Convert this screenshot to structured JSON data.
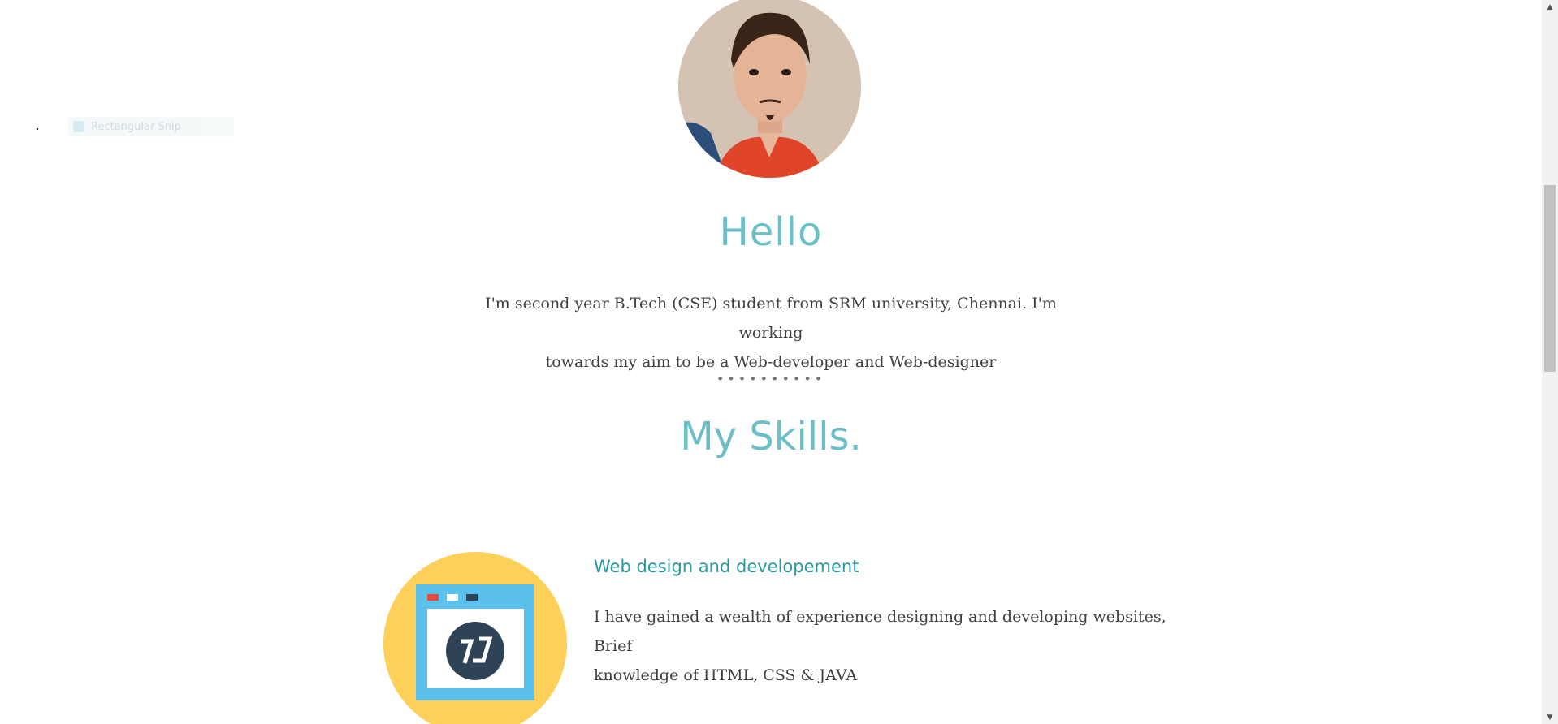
{
  "snip": {
    "label": "Rectangular Snip"
  },
  "profile": {
    "heading": "Hello",
    "intro_line1": "I'm second year B.Tech (CSE) student from SRM university, Chennai. I'm working",
    "intro_line2": "towards my aim to be a Web-developer and Web-designer"
  },
  "separator": "••••••••••",
  "skills": {
    "title": "My Skills.",
    "items": [
      {
        "title": "Web design and developement",
        "desc_line1": "I have gained a wealth of experience designing and developing websites, Brief",
        "desc_line2": "knowledge of HTML, CSS & JAVA",
        "icon": "browser-window-icon"
      }
    ]
  },
  "colors": {
    "accent": "#6bbfc5",
    "skill_title": "#2a9aa0",
    "icon_bg": "#fdd05a",
    "window_blue": "#5bc0eb"
  },
  "scrollbar": {
    "up": "▲",
    "down": "▼"
  }
}
